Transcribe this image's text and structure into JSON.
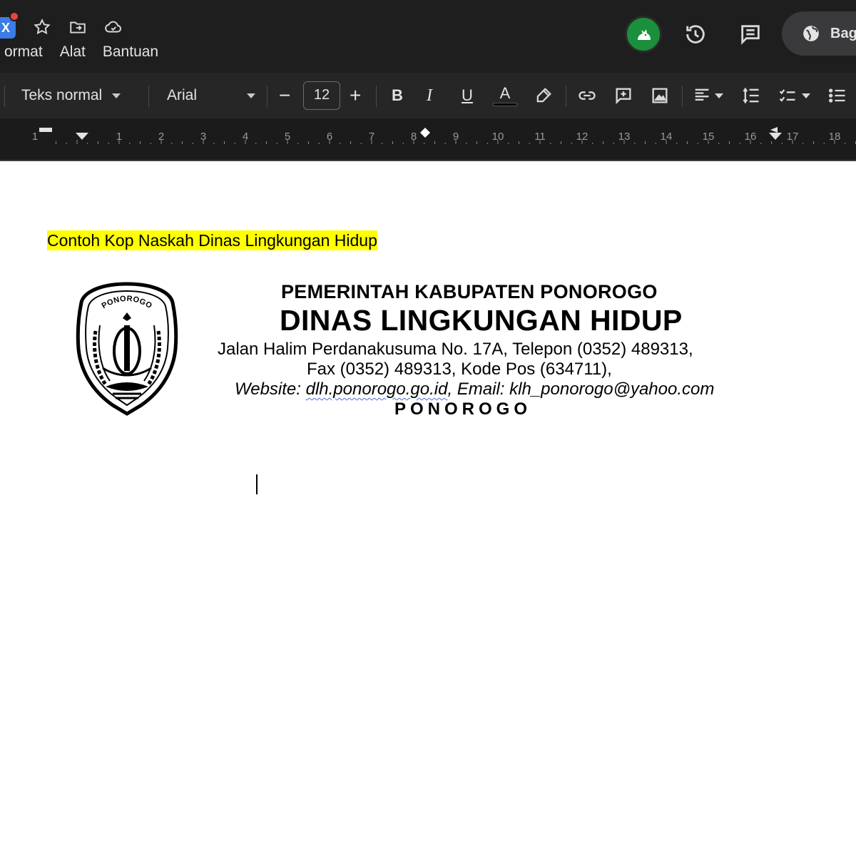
{
  "menu": {
    "items": [
      "ormat",
      "Alat",
      "Bantuan"
    ]
  },
  "doc_badge": "X",
  "share": {
    "label": "Bag"
  },
  "toolbar": {
    "style_label": "Teks normal",
    "font_label": "Arial",
    "font_size": "12",
    "minus": "−",
    "plus": "+",
    "bold": "B",
    "italic": "I",
    "underline": "U",
    "text_color": "A"
  },
  "ruler": {
    "labels": [
      "1",
      "1",
      "2",
      "3",
      "4",
      "5",
      "6",
      "7",
      "8",
      "9",
      "10",
      "11",
      "12",
      "13",
      "14",
      "15",
      "16",
      "17",
      "18"
    ]
  },
  "document": {
    "caption": "Contoh Kop Naskah Dinas Lingkungan Hidup",
    "seal_text": "PONOROGO",
    "kop": {
      "government": "PEMERINTAH KABUPATEN PONOROGO",
      "office": "DINAS LINGKUNGAN HIDUP",
      "address": "Jalan Halim Perdanakusuma No. 17A, Telepon (0352) 489313,",
      "fax": "Fax (0352) 489313, Kode Pos (634711),",
      "website_label": "Website: ",
      "website_url": "dlh.ponorogo.go.id",
      "email": ", Email: klh_ponorogo@yahoo.com",
      "city": "PONOROGO"
    }
  },
  "colors": {
    "topbar_bg": "#1e1e1f",
    "toolbar_bg": "#262626",
    "highlight": "#ffff00",
    "avatar_bg": "#1a8f3c",
    "badge_blue": "#3b7ce6",
    "notif_red": "#e8453c"
  }
}
